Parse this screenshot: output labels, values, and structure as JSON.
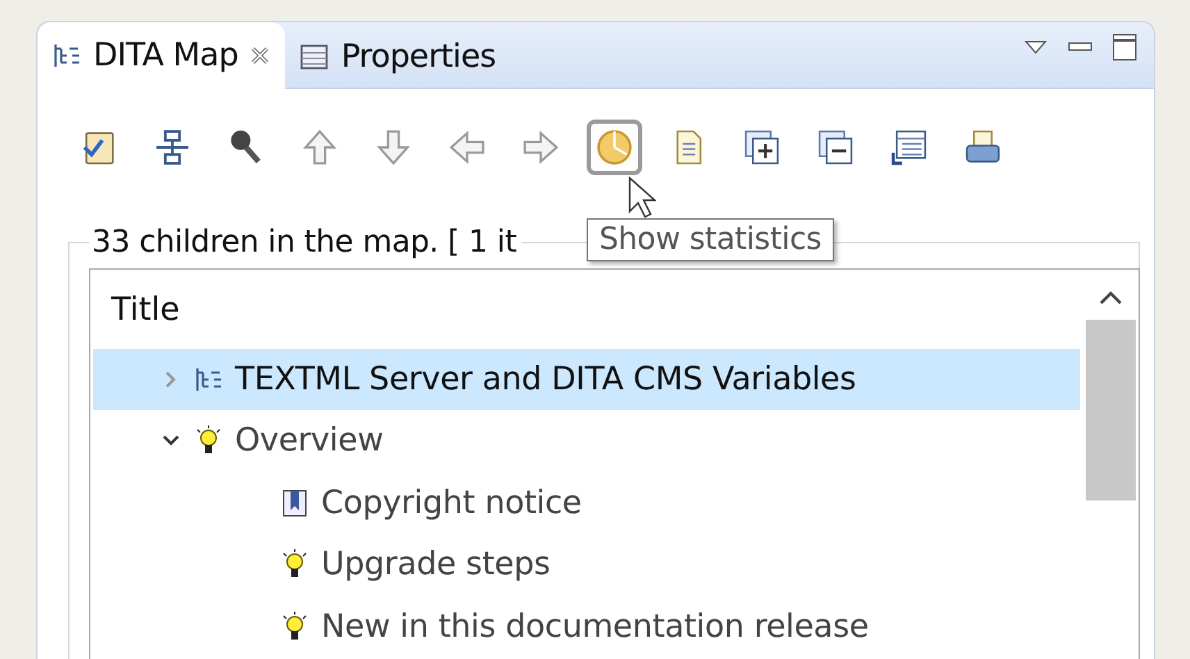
{
  "tabs": [
    {
      "label": "DITA Map",
      "kind": "map",
      "selected": true,
      "closable": true
    },
    {
      "label": "Properties",
      "kind": "properties",
      "selected": false,
      "closable": false
    }
  ],
  "toolbar": [
    {
      "kind": "validate",
      "hovered": false
    },
    {
      "kind": "structure",
      "hovered": false
    },
    {
      "kind": "key",
      "hovered": false
    },
    {
      "kind": "up",
      "hovered": false
    },
    {
      "kind": "down",
      "hovered": false
    },
    {
      "kind": "left",
      "hovered": false
    },
    {
      "kind": "right",
      "hovered": false
    },
    {
      "kind": "statistics",
      "hovered": true
    },
    {
      "kind": "document",
      "hovered": false
    },
    {
      "kind": "expand",
      "hovered": false
    },
    {
      "kind": "collapse",
      "hovered": false
    },
    {
      "kind": "list",
      "hovered": false
    },
    {
      "kind": "print",
      "hovered": false
    }
  ],
  "summary": "33 children in the map. [ 1 it",
  "tooltip": "Show statistics",
  "table": {
    "column": "Title",
    "rows": [
      {
        "title": "TEXTML Server and DITA CMS Variables",
        "kind": "map",
        "selected": true,
        "expanded": false,
        "has_children": true
      },
      {
        "title": "Overview",
        "kind": "concept",
        "selected": false,
        "expanded": true,
        "has_children": true,
        "children": [
          {
            "title": "Copyright notice",
            "kind": "reference",
            "selected": false
          },
          {
            "title": "Upgrade steps",
            "kind": "concept",
            "selected": false
          },
          {
            "title": "New in this documentation release",
            "kind": "concept",
            "selected": false
          }
        ]
      }
    ]
  }
}
